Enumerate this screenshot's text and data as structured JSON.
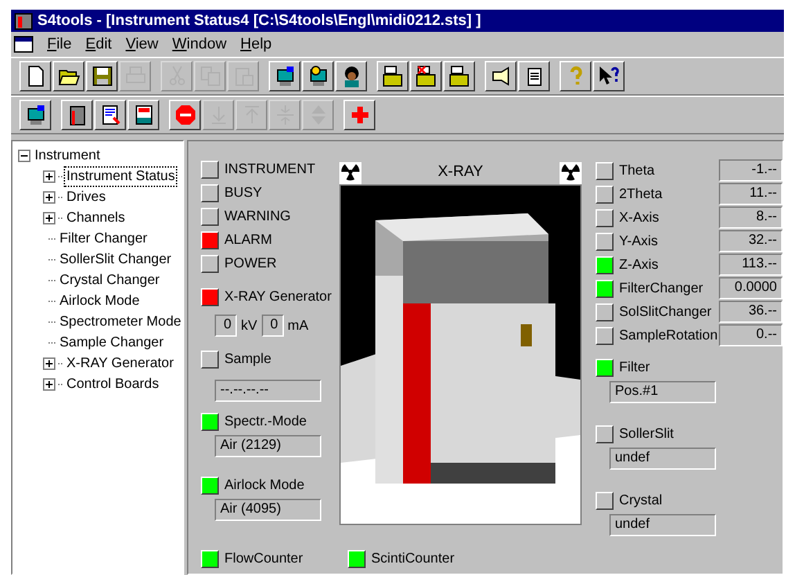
{
  "window": {
    "title": "S4tools - [Instrument Status4 [C:\\S4tools\\Engl\\midi0212.sts] ]"
  },
  "menu": [
    "File",
    "Edit",
    "View",
    "Window",
    "Help"
  ],
  "toolbar_1": [
    [
      {
        "kind": "new",
        "disabled": false
      },
      {
        "kind": "open",
        "disabled": false
      },
      {
        "kind": "save",
        "disabled": false
      },
      {
        "kind": "print",
        "disabled": true
      }
    ],
    [
      {
        "kind": "cut",
        "disabled": true
      },
      {
        "kind": "copy",
        "disabled": true
      },
      {
        "kind": "paste",
        "disabled": true
      }
    ],
    [
      {
        "kind": "monitor",
        "disabled": false
      },
      {
        "kind": "monitor2",
        "disabled": false
      },
      {
        "kind": "person",
        "disabled": false
      }
    ],
    [
      {
        "kind": "folder",
        "disabled": false
      },
      {
        "kind": "folderx",
        "disabled": false
      },
      {
        "kind": "folder",
        "disabled": false
      }
    ],
    [
      {
        "kind": "bulb",
        "disabled": false
      },
      {
        "kind": "clipboard",
        "disabled": false
      }
    ],
    [
      {
        "kind": "help",
        "disabled": false
      },
      {
        "kind": "pointerhelp",
        "disabled": false
      }
    ]
  ],
  "toolbar_2": [
    [
      {
        "kind": "monitor",
        "disabled": false
      }
    ],
    [
      {
        "kind": "cabinet",
        "disabled": false
      },
      {
        "kind": "report",
        "disabled": false
      },
      {
        "kind": "doc",
        "disabled": false
      }
    ],
    [
      {
        "kind": "stop",
        "disabled": false
      },
      {
        "kind": "down",
        "disabled": true
      },
      {
        "kind": "up",
        "disabled": true
      },
      {
        "kind": "center",
        "disabled": true
      },
      {
        "kind": "updown",
        "disabled": true
      }
    ],
    [
      {
        "kind": "cross",
        "disabled": false
      }
    ]
  ],
  "tree": [
    {
      "label": "Instrument",
      "expanded": true,
      "selected": false,
      "children": [
        {
          "label": "Instrument Status",
          "expanded": false,
          "selected": true
        },
        {
          "label": "Drives",
          "expanded": false,
          "selected": false
        },
        {
          "label": "Channels",
          "expanded": false,
          "selected": false
        },
        {
          "label": "Filter Changer",
          "selected": false
        },
        {
          "label": "SollerSlit Changer",
          "selected": false
        },
        {
          "label": "Crystal Changer",
          "selected": false
        },
        {
          "label": "Airlock Mode",
          "selected": false
        },
        {
          "label": "Spectrometer Mode",
          "selected": false
        },
        {
          "label": "Sample Changer",
          "selected": false
        },
        {
          "label": "X-RAY Generator",
          "expanded": false,
          "selected": false
        },
        {
          "label": "Control Boards",
          "expanded": false,
          "selected": false
        }
      ]
    }
  ],
  "status_lamps": [
    {
      "label": "INSTRUMENT",
      "color": "#c0c0c0"
    },
    {
      "label": "BUSY",
      "color": "#c0c0c0"
    },
    {
      "label": "WARNING",
      "color": "#c0c0c0"
    },
    {
      "label": "ALARM",
      "color": "#ff0000"
    },
    {
      "label": "POWER",
      "color": "#c0c0c0"
    }
  ],
  "xray_generator": {
    "label": "X-RAY Generator",
    "color": "#ff0000",
    "kv": "0",
    "kv_unit": "kV",
    "ma": "0",
    "ma_unit": "mA"
  },
  "left_fields": [
    {
      "label": "Sample",
      "color": "#c0c0c0",
      "value": "--.--.--.--"
    },
    {
      "label": "Spectr.-Mode",
      "color": "#00ff00",
      "value": "Air (2129)"
    },
    {
      "label": "Airlock Mode",
      "color": "#00ff00",
      "value": "Air (4095)"
    }
  ],
  "picture": {
    "title": "X-RAY"
  },
  "axes": [
    {
      "label": "Theta",
      "color": "#c0c0c0",
      "value": "-1.--"
    },
    {
      "label": "2Theta",
      "color": "#c0c0c0",
      "value": "11.--"
    },
    {
      "label": "X-Axis",
      "color": "#c0c0c0",
      "value": "8.--"
    },
    {
      "label": "Y-Axis",
      "color": "#c0c0c0",
      "value": "32.--"
    },
    {
      "label": "Z-Axis",
      "color": "#00ff00",
      "value": "113.--"
    },
    {
      "label": "FilterChanger",
      "color": "#00ff00",
      "value": "0.0000"
    },
    {
      "label": "SolSlitChanger",
      "color": "#c0c0c0",
      "value": "36.--"
    },
    {
      "label": "SampleRotation",
      "color": "#c0c0c0",
      "value": "0.--"
    }
  ],
  "right_fields": [
    {
      "label": "Filter",
      "color": "#00ff00",
      "value": "Pos.#1"
    },
    {
      "label": "SollerSlit",
      "color": "#c0c0c0",
      "value": "undef"
    },
    {
      "label": "Crystal",
      "color": "#c0c0c0",
      "value": "undef"
    }
  ],
  "counters": [
    {
      "label": "FlowCounter",
      "color": "#00ff00"
    },
    {
      "label": "ScintiCounter",
      "color": "#00ff00"
    }
  ]
}
